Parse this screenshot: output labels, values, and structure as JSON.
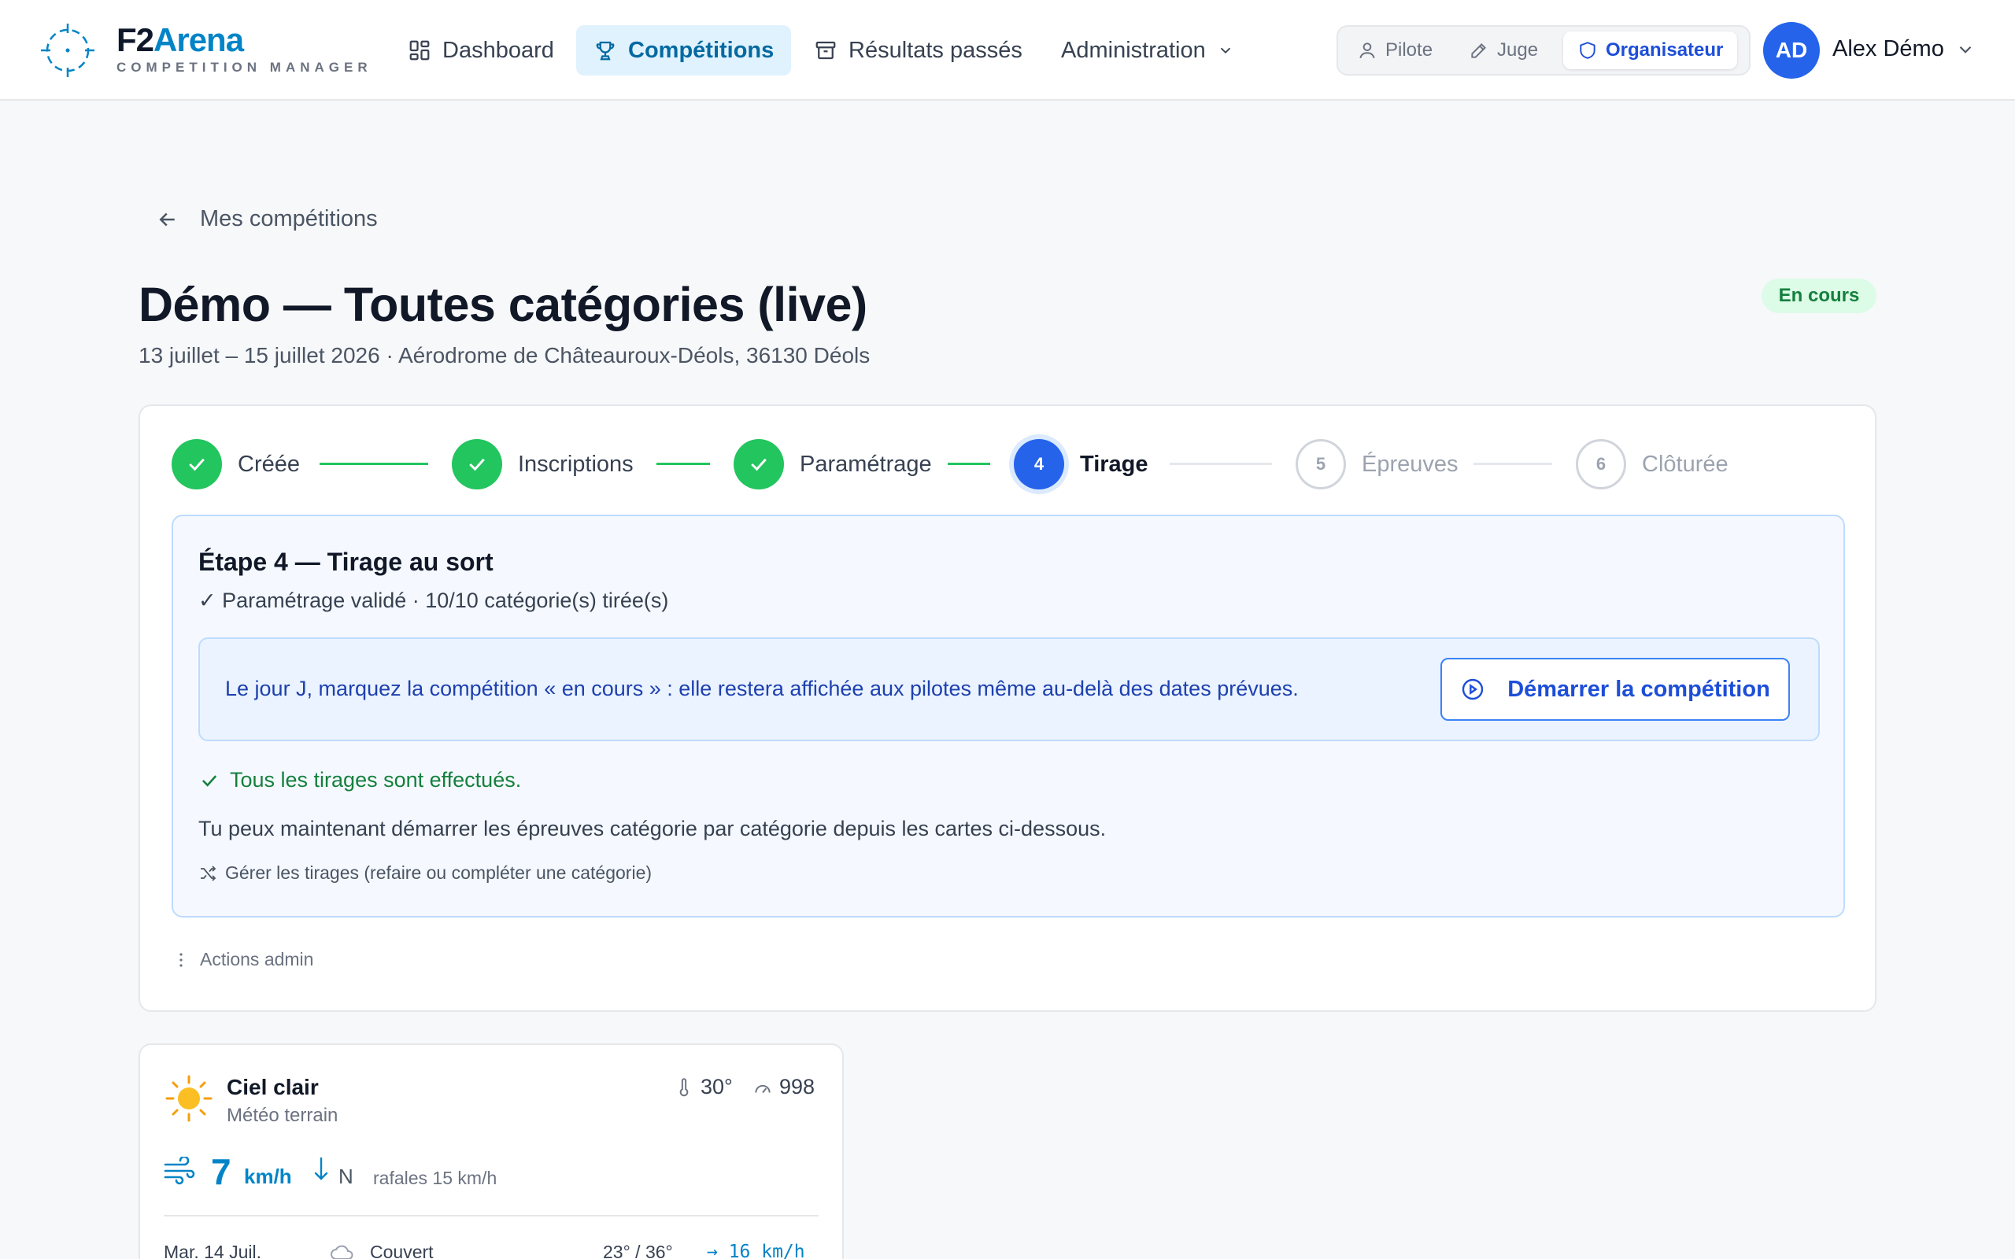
{
  "app": {
    "brand_part1": "F2",
    "brand_part2": "Arena",
    "brand_tagline": "COMPETITION MANAGER"
  },
  "nav": {
    "items": [
      {
        "label": "Dashboard",
        "icon": "dashboard-icon"
      },
      {
        "label": "Compétitions",
        "icon": "trophy-icon",
        "active": true
      },
      {
        "label": "Résultats passés",
        "icon": "archive-icon"
      },
      {
        "label": "Administration",
        "icon": "chevron-down-icon"
      }
    ]
  },
  "roles": {
    "items": [
      {
        "label": "Pilote",
        "icon": "user-icon"
      },
      {
        "label": "Juge",
        "icon": "pencil-icon"
      },
      {
        "label": "Organisateur",
        "icon": "shield-icon",
        "active": true
      }
    ]
  },
  "user": {
    "initials": "AD",
    "name": "Alex Démo"
  },
  "breadcrumb": {
    "back_label": "Mes compétitions"
  },
  "competition": {
    "title": "Démo — Toutes catégories (live)",
    "subtitle": "13 juillet – 15 juillet 2026 · Aérodrome de Châteauroux-Déols, 36130 Déols",
    "status": "En cours"
  },
  "steps": [
    {
      "number": "1",
      "label": "Créée",
      "state": "done"
    },
    {
      "number": "2",
      "label": "Inscriptions",
      "state": "done"
    },
    {
      "number": "3",
      "label": "Paramétrage",
      "state": "done"
    },
    {
      "number": "4",
      "label": "Tirage",
      "state": "current"
    },
    {
      "number": "5",
      "label": "Épreuves",
      "state": "todo"
    },
    {
      "number": "6",
      "label": "Clôturée",
      "state": "todo"
    }
  ],
  "stage": {
    "title": "Étape 4 — Tirage au sort",
    "check_line": "✓ Paramétrage validé · 10/10 catégorie(s) tirée(s)",
    "info_text": "Le jour J, marquez la compétition « en cours » : elle restera affichée aux pilotes même au-delà des dates prévues.",
    "start_button": "Démarrer la compétition",
    "draws_done": "Tous les tirages sont effectués.",
    "next_info": "Tu peux maintenant démarrer les épreuves catégorie par catégorie depuis les cartes ci-dessous.",
    "manage_link": "Gérer les tirages (refaire ou compléter une catégorie)"
  },
  "admin_actions": {
    "label": "Actions admin"
  },
  "weather": {
    "condition": "Ciel clair",
    "source": "Météo terrain",
    "temperature": "30°",
    "pressure": "998",
    "wind_speed": "7",
    "wind_unit": "km/h",
    "wind_direction": "N",
    "gusts": "rafales 15 km/h",
    "forecast": [
      {
        "date": "Mar. 14 Juil.",
        "condition": "Couvert",
        "temps": "23° / 36°",
        "wind": "→ 16 km/h"
      }
    ]
  },
  "colors": {
    "accent": "#2563eb",
    "brand": "#0284c7",
    "success": "#22c55e"
  }
}
